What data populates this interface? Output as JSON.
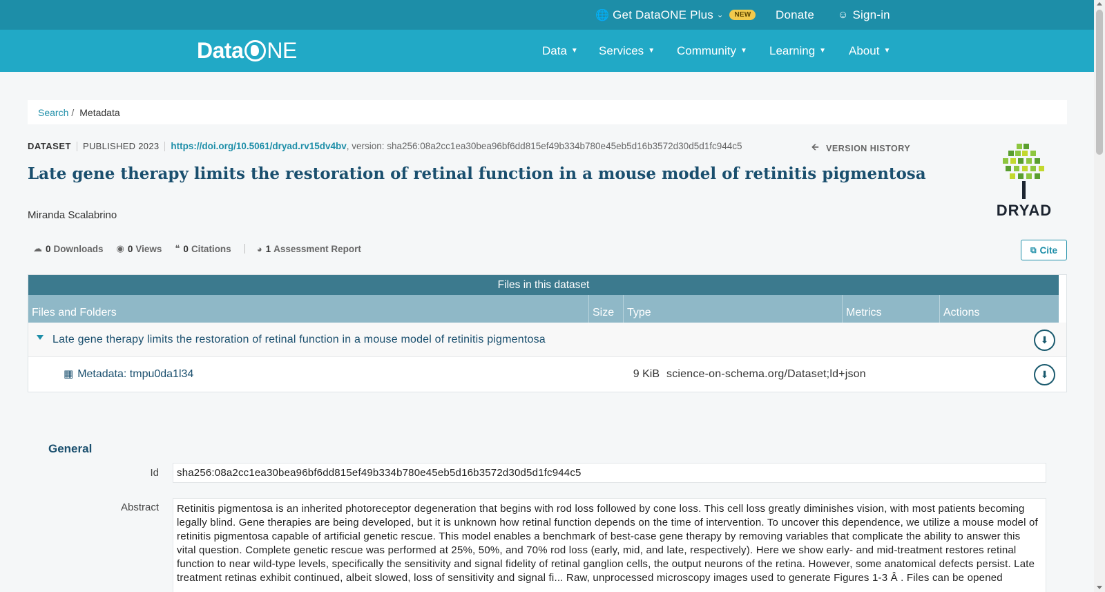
{
  "topbar": {
    "plus_label": "Get DataONE Plus",
    "new_badge": "NEW",
    "donate": "Donate",
    "signin": "Sign-in"
  },
  "navbar": {
    "logo_left": "Data",
    "logo_right": "NE",
    "items": [
      "Data",
      "Services",
      "Community",
      "Learning",
      "About"
    ]
  },
  "breadcrumb": {
    "link": "Search",
    "separator": "/",
    "current": "Metadata"
  },
  "dataset": {
    "type_label": "DATASET",
    "published": "PUBLISHED 2023",
    "doi": "https://doi.org/10.5061/dryad.rv15dv4bv",
    "version": ", version: sha256:08a2cc1ea30bea96bf6dd815ef49b334b780e45eb5d16b3572d30d5d1fc944c5",
    "version_history": "VERSION HISTORY",
    "title": "Late gene therapy limits the restoration of retinal function in a mouse model of retinitis pigmentosa",
    "author": "Miranda Scalabrino",
    "repository_logo_text": "DRYAD"
  },
  "stats": {
    "downloads_count": "0",
    "downloads_label": "Downloads",
    "views_count": "0",
    "views_label": "Views",
    "citations_count": "0",
    "citations_label": "Citations",
    "assessment_count": "1",
    "assessment_label": "Assessment Report",
    "cite_button": "Cite"
  },
  "files": {
    "title": "Files in this dataset",
    "columns": [
      "Files and Folders",
      "Size",
      "Type",
      "Metrics",
      "Actions"
    ],
    "folder_name": "Late gene therapy limits the restoration of retinal function in a mouse model of retinitis pigmentosa",
    "metadata_name": "Metadata: tmpu0da1l34",
    "metadata_size": "9 KiB",
    "metadata_type": "science-on-schema.org/Dataset;ld+json"
  },
  "general": {
    "heading": "General",
    "id_label": "Id",
    "id_value": "sha256:08a2cc1ea30bea96bf6dd815ef49b334b780e45eb5d16b3572d30d5d1fc944c5",
    "abstract_label": "Abstract",
    "abstract_value": "Retinitis pigmentosa is an inherited photoreceptor degeneration that begins with rod loss followed by cone loss. This cell loss greatly diminishes vision, with most patients becoming legally blind. Gene therapies are being developed, but it is unknown how retinal function depends on the time of intervention. To uncover this dependence, we utilize a mouse model of retinitis pigmentosa capable of artificial genetic rescue. This model enables a benchmark of best-case gene therapy by removing variables that complicate the ability to answer this vital question. Complete genetic rescue was performed at 25%, 50%, and 70% rod loss (early, mid, and late, respectively). Here we show early- and mid-treatment restores retinal function to near wild-type levels, specifically the sensitivity and signal fidelity of retinal ganglion cells, the output neurons of the retina. However, some anatomical defects persist. Late treatment retinas exhibit continued, albeit slowed, loss of sensitivity and signal fi... Raw, unprocessed microscopy images used to generate Figures 1-3 Â . Files can be opened"
  },
  "colors": {
    "topbar": "#1d8ea8",
    "navbar": "#21a9c6",
    "title": "#1a4f6e",
    "table_title": "#3c7a8e",
    "table_header": "#8fb8c7",
    "badge": "#f2c94c"
  }
}
